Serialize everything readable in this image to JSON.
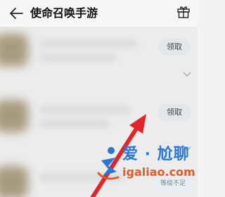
{
  "header": {
    "title": "使命召唤手游",
    "back_icon": "arrow-left-icon",
    "gift_icon": "gift-icon"
  },
  "gift_rows": [
    {
      "claim_label": "领取"
    },
    {
      "claim_label": "领取"
    }
  ],
  "level_badge": "等级不足",
  "watermark": {
    "brand": "爱 · 尬聊",
    "domain": "igaliao.com"
  },
  "colors": {
    "arrow": "#e0262a",
    "watermark_blue": "#2a78d4",
    "watermark_orange": "#e15b2a"
  }
}
